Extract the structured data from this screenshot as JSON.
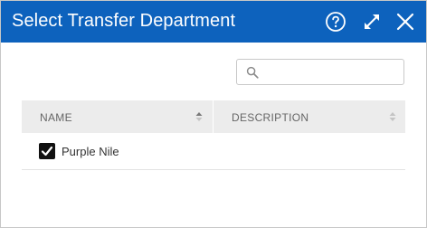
{
  "dialog": {
    "title": "Select Transfer Department",
    "icons": {
      "help": "help-circle-icon",
      "expand": "expand-icon",
      "close": "close-icon"
    },
    "colors": {
      "titlebar": "#0d62bd",
      "header_bg": "#ececec"
    }
  },
  "search": {
    "value": "",
    "placeholder": "",
    "icon": "search-icon"
  },
  "table": {
    "columns": [
      {
        "label": "NAME"
      },
      {
        "label": "DESCRIPTION"
      }
    ],
    "rows": [
      {
        "name": "Purple Nile",
        "description": "",
        "checked": true
      }
    ]
  }
}
